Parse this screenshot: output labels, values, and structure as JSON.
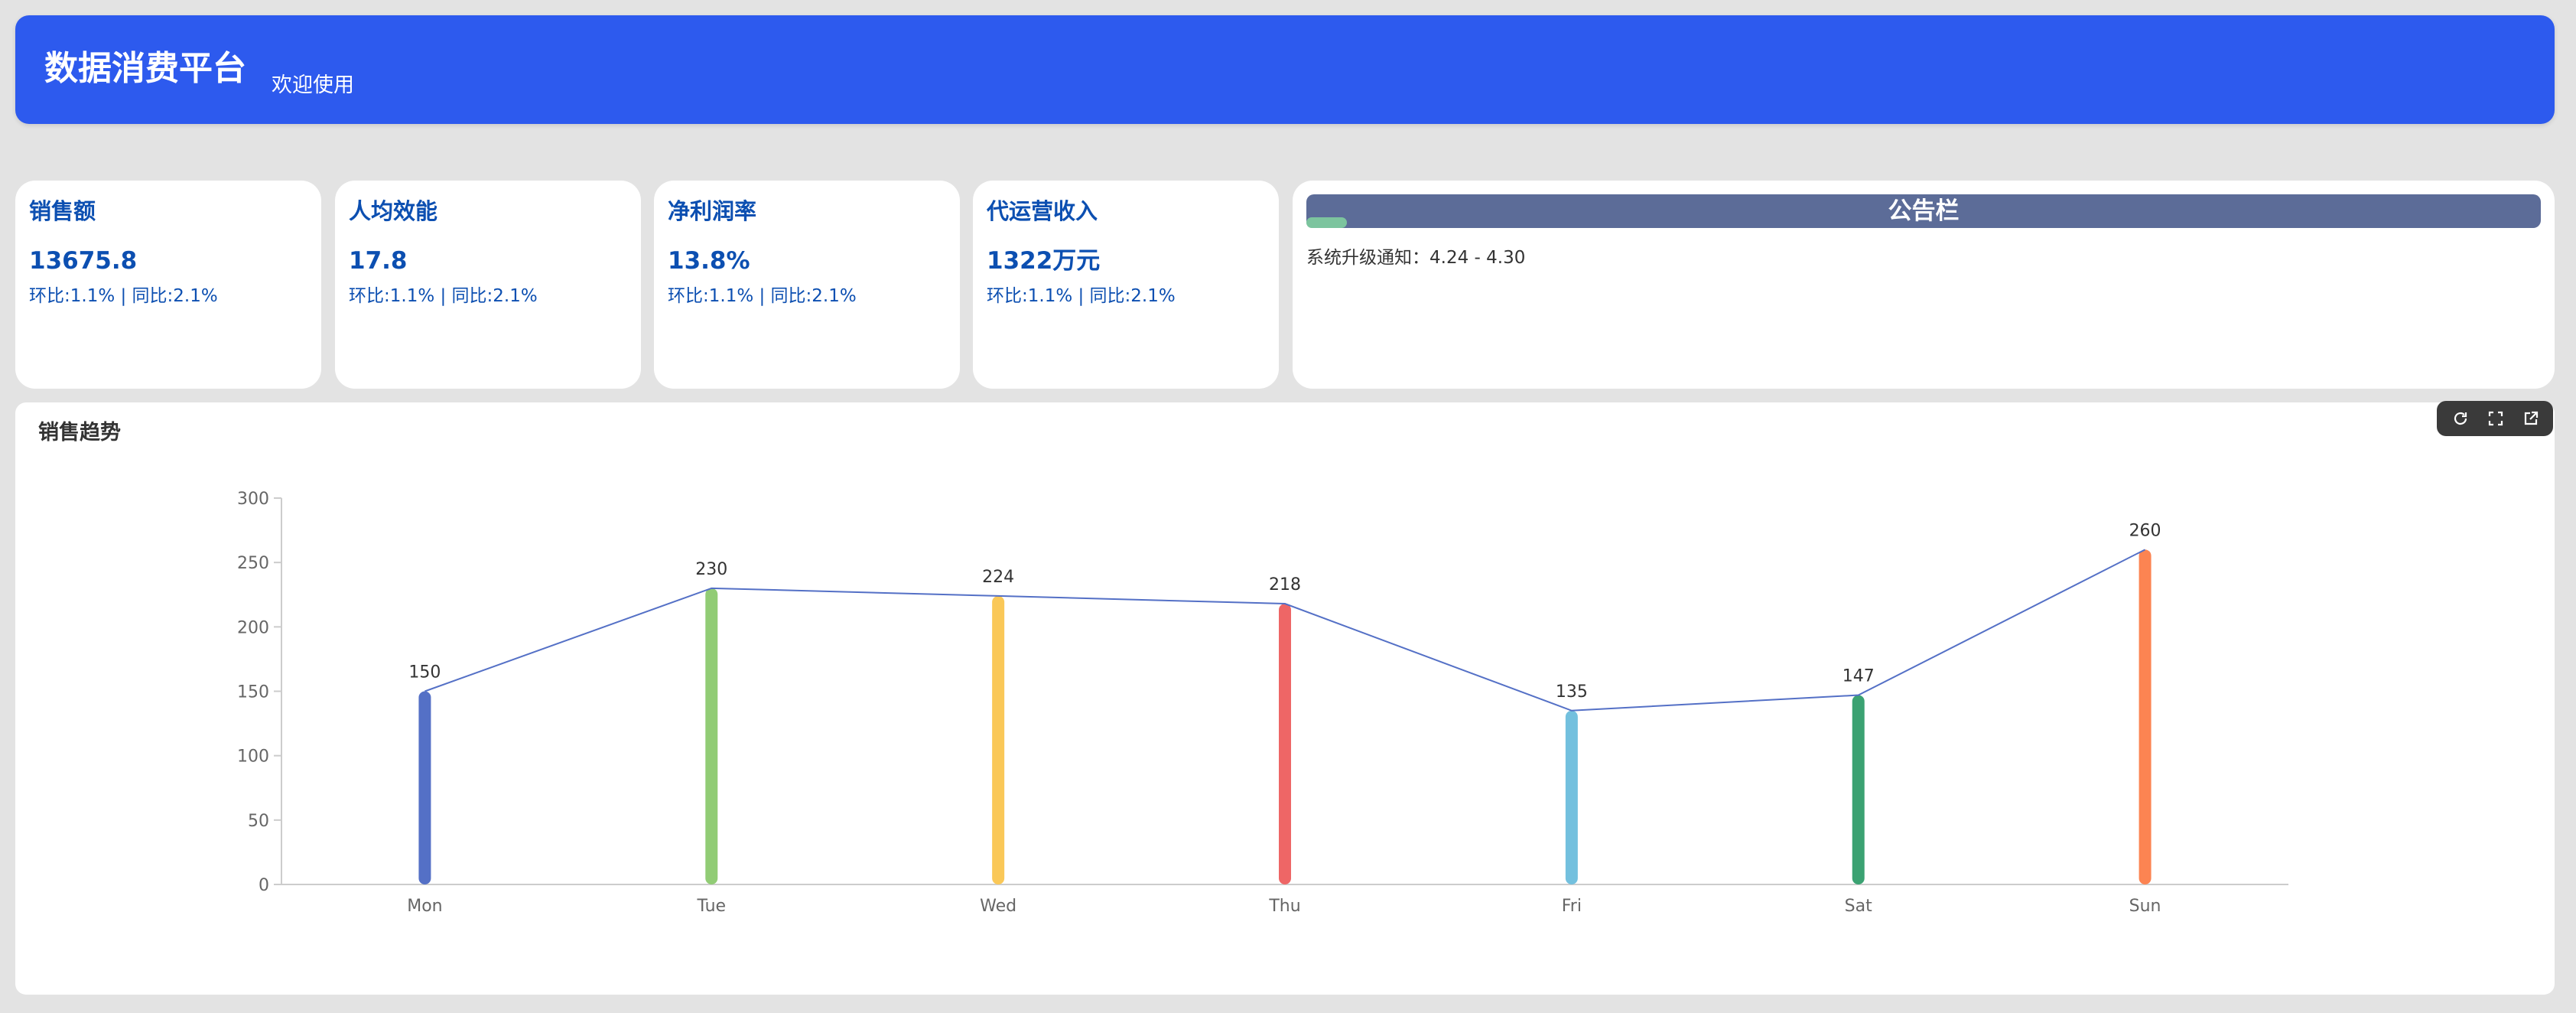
{
  "header": {
    "title": "数据消费平台",
    "welcome": "欢迎使用"
  },
  "kpis": [
    {
      "title": "销售额",
      "value": "13675.8",
      "sub": "环比:1.1% | 同比:2.1%"
    },
    {
      "title": "人均效能",
      "value": "17.8",
      "sub": "环比:1.1% | 同比:2.1%"
    },
    {
      "title": "净利润率",
      "value": "13.8%",
      "sub": "环比:1.1% | 同比:2.1%"
    },
    {
      "title": "代运营收入",
      "value": "1322万元",
      "sub": "环比:1.1% | 同比:2.1%"
    }
  ],
  "notice": {
    "title": "公告栏",
    "progress": 0.033,
    "items": [
      "系统升级通知：4.24 - 4.30"
    ]
  },
  "chart_card": {
    "title": "销售趋势"
  },
  "toolbar": {
    "icons": [
      "refresh-icon",
      "fullscreen-icon",
      "open-external-icon"
    ]
  },
  "chart_data": {
    "type": "bar",
    "categories": [
      "Mon",
      "Tue",
      "Wed",
      "Thu",
      "Fri",
      "Sat",
      "Sun"
    ],
    "values": [
      150,
      230,
      224,
      218,
      135,
      147,
      260
    ],
    "colors": [
      "#5470c6",
      "#91cc75",
      "#fac858",
      "#ee6666",
      "#73c0de",
      "#3ba272",
      "#fc8452"
    ],
    "line_color": "#5470c6",
    "yticks": [
      0,
      50,
      100,
      150,
      200,
      250,
      300
    ],
    "ylim": [
      0,
      300
    ],
    "overlay_line": true,
    "grid": false
  }
}
